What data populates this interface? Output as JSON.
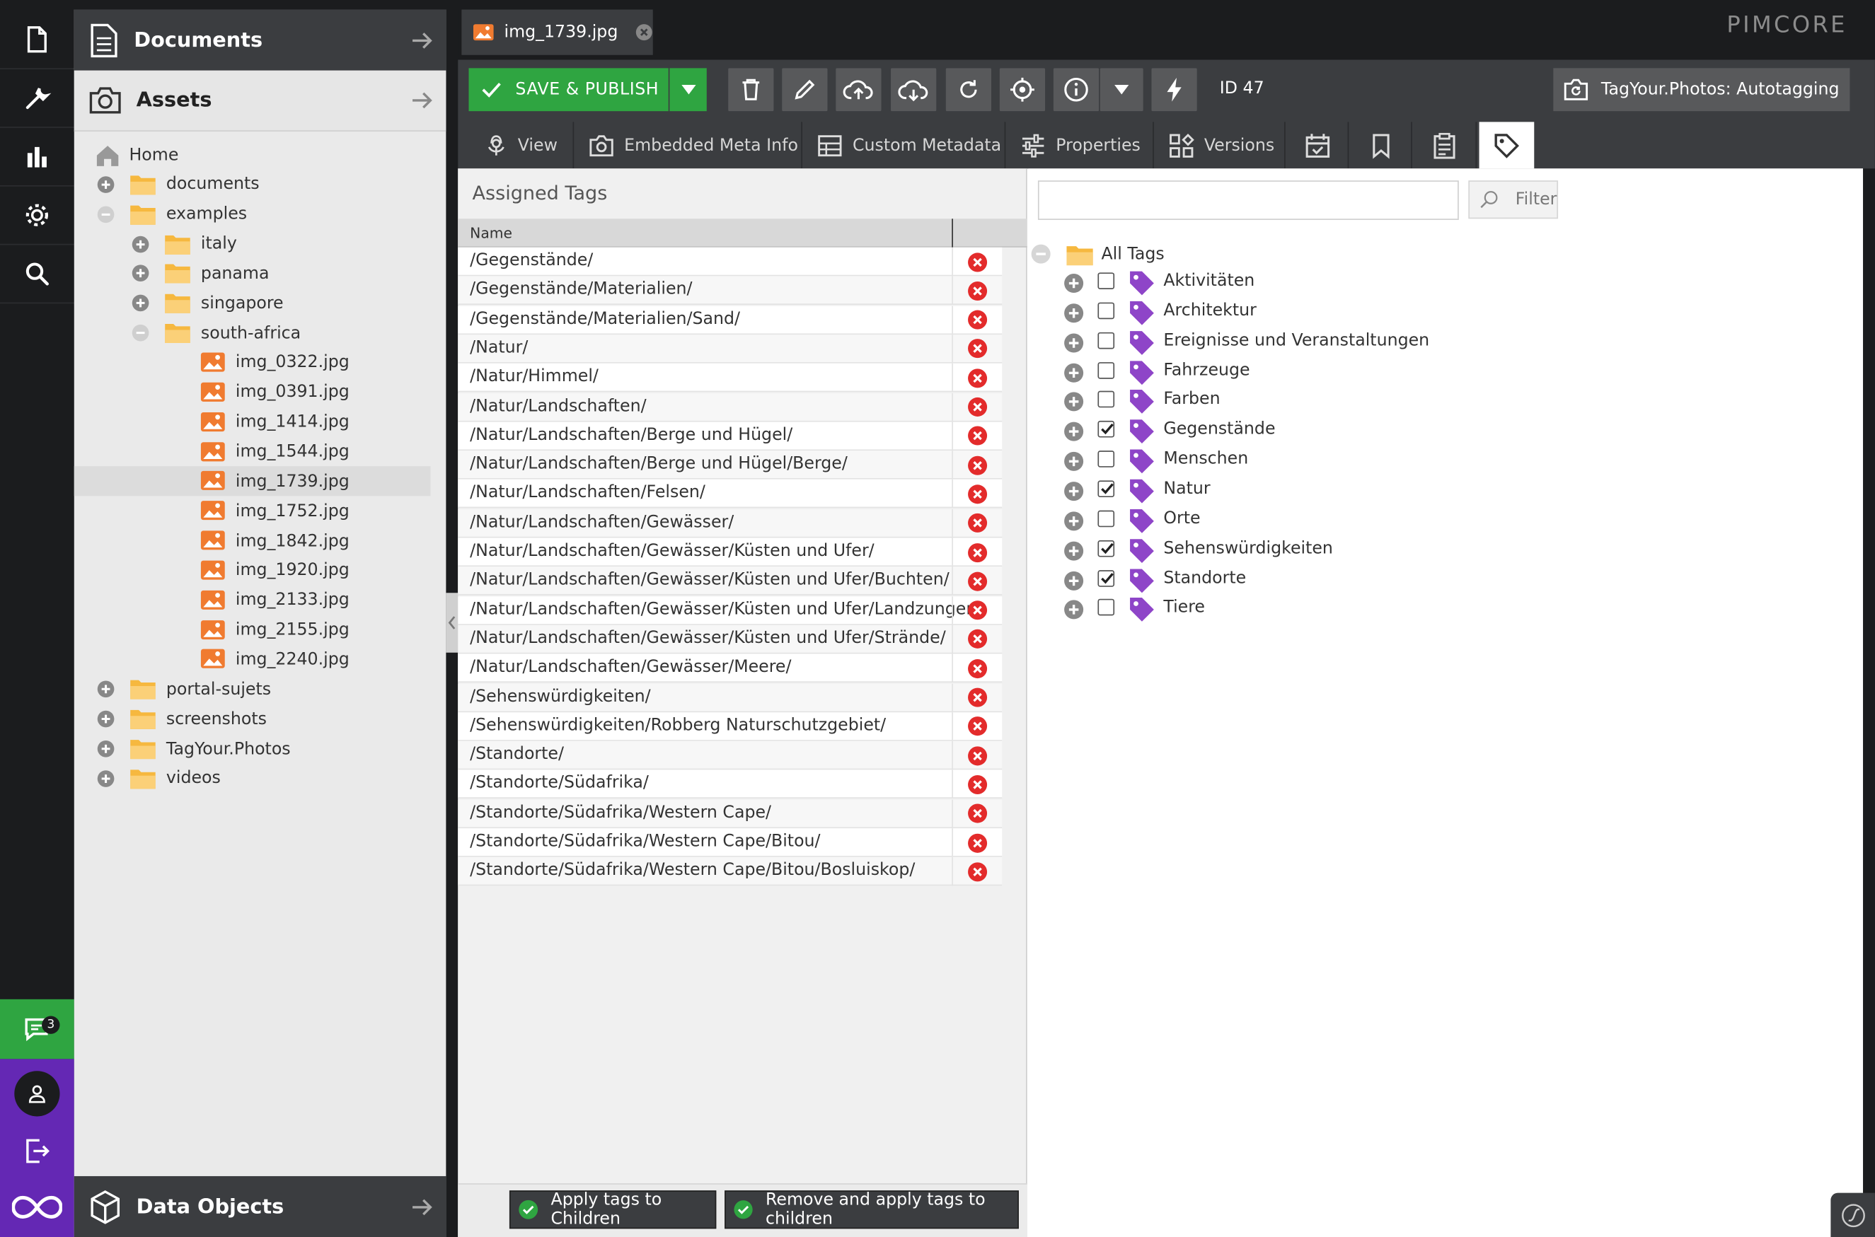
{
  "colors": {
    "green": "#2fa541",
    "purple": "#6428b4",
    "dark": "#3b3d40",
    "tag": "#8e45c8",
    "folder": "#f6b83f",
    "asset_icon": "#f07b30",
    "delete": "#e32b2b"
  },
  "sidebar": {
    "chat_count": "3",
    "icons": [
      "document-icon",
      "wrench-icon",
      "bar-chart-icon",
      "gear-icon",
      "search-icon",
      "chat-icon",
      "user-icon",
      "logout-icon",
      "infinity-icon"
    ]
  },
  "panels": {
    "documents": "Documents",
    "assets": "Assets",
    "data_objects": "Data Objects"
  },
  "tree": [
    {
      "label": "Home",
      "level": 0,
      "type": "home"
    },
    {
      "label": "documents",
      "level": 0,
      "type": "folder",
      "expander": "plus"
    },
    {
      "label": "examples",
      "level": 0,
      "type": "folder",
      "expander": "minus"
    },
    {
      "label": "italy",
      "level": 1,
      "type": "folder",
      "expander": "plus"
    },
    {
      "label": "panama",
      "level": 1,
      "type": "folder",
      "expander": "plus"
    },
    {
      "label": "singapore",
      "level": 1,
      "type": "folder",
      "expander": "plus"
    },
    {
      "label": "south-africa",
      "level": 1,
      "type": "folder",
      "expander": "minus"
    },
    {
      "label": "img_0322.jpg",
      "level": 2,
      "type": "image"
    },
    {
      "label": "img_0391.jpg",
      "level": 2,
      "type": "image"
    },
    {
      "label": "img_1414.jpg",
      "level": 2,
      "type": "image"
    },
    {
      "label": "img_1544.jpg",
      "level": 2,
      "type": "image"
    },
    {
      "label": "img_1739.jpg",
      "level": 2,
      "type": "image",
      "selected": true
    },
    {
      "label": "img_1752.jpg",
      "level": 2,
      "type": "image"
    },
    {
      "label": "img_1842.jpg",
      "level": 2,
      "type": "image"
    },
    {
      "label": "img_1920.jpg",
      "level": 2,
      "type": "image"
    },
    {
      "label": "img_2133.jpg",
      "level": 2,
      "type": "image"
    },
    {
      "label": "img_2155.jpg",
      "level": 2,
      "type": "image"
    },
    {
      "label": "img_2240.jpg",
      "level": 2,
      "type": "image"
    },
    {
      "label": "portal-sujets",
      "level": 0,
      "type": "folder",
      "expander": "plus"
    },
    {
      "label": "screenshots",
      "level": 0,
      "type": "folder",
      "expander": "plus"
    },
    {
      "label": "TagYour.Photos",
      "level": 0,
      "type": "folder",
      "expander": "plus"
    },
    {
      "label": "videos",
      "level": 0,
      "type": "folder",
      "expander": "plus"
    }
  ],
  "editor": {
    "tab_title": "img_1739.jpg",
    "logo": "PIMCORE",
    "save_label": "SAVE & PUBLISH",
    "id_label": "ID 47",
    "autotag_label": "TagYour.Photos: Autotagging",
    "subtabs": [
      "View",
      "Embedded Meta Info",
      "Custom Metadata",
      "Properties",
      "Versions"
    ]
  },
  "assigned": {
    "title": "Assigned Tags",
    "column": "Name",
    "rows": [
      "/Gegenstände/",
      "/Gegenstände/Materialien/",
      "/Gegenstände/Materialien/Sand/",
      "/Natur/",
      "/Natur/Himmel/",
      "/Natur/Landschaften/",
      "/Natur/Landschaften/Berge und Hügel/",
      "/Natur/Landschaften/Berge und Hügel/Berge/",
      "/Natur/Landschaften/Felsen/",
      "/Natur/Landschaften/Gewässer/",
      "/Natur/Landschaften/Gewässer/Küsten und Ufer/",
      "/Natur/Landschaften/Gewässer/Küsten und Ufer/Buchten/",
      "/Natur/Landschaften/Gewässer/Küsten und Ufer/Landzungen/",
      "/Natur/Landschaften/Gewässer/Küsten und Ufer/Strände/",
      "/Natur/Landschaften/Gewässer/Meere/",
      "/Sehenswürdigkeiten/",
      "/Sehenswürdigkeiten/Robberg Naturschutzgebiet/",
      "/Standorte/",
      "/Standorte/Südafrika/",
      "/Standorte/Südafrika/Western Cape/",
      "/Standorte/Südafrika/Western Cape/Bitou/",
      "/Standorte/Südafrika/Western Cape/Bitou/Bosluiskop/"
    ],
    "apply_children": "Apply tags to Children",
    "remove_apply_children": "Remove and apply tags to children"
  },
  "tagtree": {
    "search_value": "",
    "filter_label": "Filter",
    "root": "All Tags",
    "tags": [
      {
        "label": "Aktivitäten",
        "checked": false
      },
      {
        "label": "Architektur",
        "checked": false
      },
      {
        "label": "Ereignisse und Veranstaltungen",
        "checked": false
      },
      {
        "label": "Fahrzeuge",
        "checked": false
      },
      {
        "label": "Farben",
        "checked": false
      },
      {
        "label": "Gegenstände",
        "checked": true
      },
      {
        "label": "Menschen",
        "checked": false
      },
      {
        "label": "Natur",
        "checked": true
      },
      {
        "label": "Orte",
        "checked": false
      },
      {
        "label": "Sehenswürdigkeiten",
        "checked": true
      },
      {
        "label": "Standorte",
        "checked": true
      },
      {
        "label": "Tiere",
        "checked": false
      }
    ]
  }
}
